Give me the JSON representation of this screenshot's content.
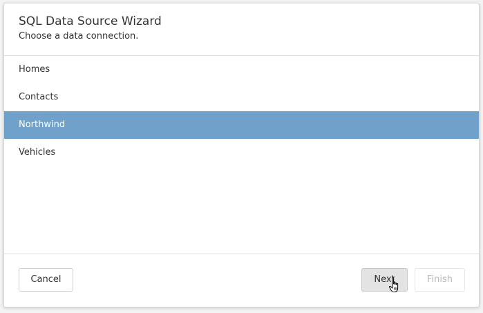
{
  "dialog": {
    "title": "SQL Data Source Wizard",
    "subtitle": "Choose a data connection."
  },
  "connections": [
    {
      "label": "Homes",
      "selected": false
    },
    {
      "label": "Contacts",
      "selected": false
    },
    {
      "label": "Northwind",
      "selected": true
    },
    {
      "label": "Vehicles",
      "selected": false
    }
  ],
  "footer": {
    "cancel_label": "Cancel",
    "next_label": "Next",
    "finish_label": "Finish",
    "finish_enabled": false
  },
  "colors": {
    "selection": "#6fa1cb",
    "next_button_bg": "#e3e3e3",
    "disabled_text": "#b8b8b8"
  },
  "icons": {
    "cursor": "hand-pointer-icon"
  }
}
